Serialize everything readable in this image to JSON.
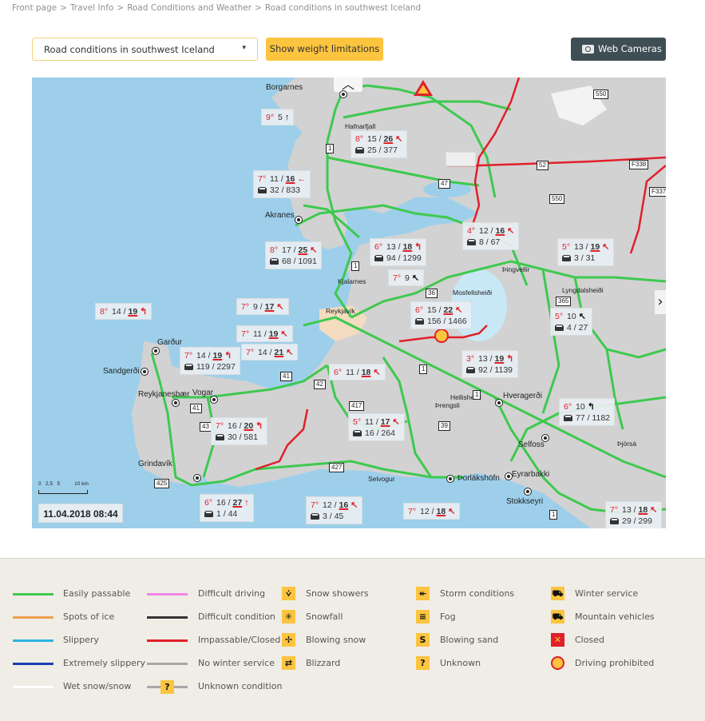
{
  "breadcrumb": [
    "Front page",
    "Travel Info",
    "Road Conditions and Weather",
    "Road conditions in southwest Iceland"
  ],
  "breadcrumb_separator": ">",
  "controls": {
    "region_select_value": "Road conditions in southwest Iceland",
    "weight_button": "Show weight limitations",
    "webcam_button": "Web Cameras"
  },
  "map": {
    "collapse_icon": "chevron-up-icon",
    "next_icon": "chevron-right-icon",
    "timestamp": "11.04.2018  08:44",
    "scale_labels": "0   2,5   5          10 km",
    "places": [
      {
        "name": "Borgarnes",
        "cls": ""
      },
      {
        "name": "Hafnarfjall",
        "cls": "small"
      },
      {
        "name": "Akranes",
        "cls": ""
      },
      {
        "name": "Kjalarnes",
        "cls": "small"
      },
      {
        "name": "Mosfellsheiði",
        "cls": "small"
      },
      {
        "name": "Þingvellir",
        "cls": "small"
      },
      {
        "name": "Lyngdalsheiði",
        "cls": "small"
      },
      {
        "name": "Reykjavík",
        "cls": "small"
      },
      {
        "name": "Garður",
        "cls": ""
      },
      {
        "name": "Sandgerði",
        "cls": ""
      },
      {
        "name": "Reykjanesbær",
        "cls": ""
      },
      {
        "name": "Vogar",
        "cls": ""
      },
      {
        "name": "Hellisheiði",
        "cls": "small"
      },
      {
        "name": "Þrengsli",
        "cls": "small"
      },
      {
        "name": "Hveragerði",
        "cls": ""
      },
      {
        "name": "Selfoss",
        "cls": ""
      },
      {
        "name": "Þjórsá",
        "cls": "small"
      },
      {
        "name": "Grindavík",
        "cls": ""
      },
      {
        "name": "Selvogur",
        "cls": "small"
      },
      {
        "name": "Þorlákshöfn",
        "cls": ""
      },
      {
        "name": "Eyrarbakki",
        "cls": ""
      },
      {
        "name": "Stokkseyri",
        "cls": ""
      }
    ],
    "road_numbers": [
      "550",
      "52",
      "F338",
      "F337",
      "550",
      "1",
      "47",
      "1",
      "36",
      "365",
      "41",
      "42",
      "1",
      "1",
      "417",
      "39",
      "43",
      "41",
      "1",
      "425",
      "427"
    ],
    "weather_stations": [
      {
        "temp": "9°",
        "wind": "5",
        "gust": "",
        "dir": "↑",
        "dir_color": "black",
        "traffic": ""
      },
      {
        "temp": "8°",
        "wind": "15 /",
        "gust": "26",
        "dir": "↖",
        "dir_color": "red",
        "traffic": "25 / 377"
      },
      {
        "temp": "7°",
        "wind": "11 /",
        "gust": "16",
        "dir": "←",
        "dir_color": "red",
        "traffic": "32 / 833"
      },
      {
        "temp": "8°",
        "wind": "17 /",
        "gust": "25",
        "dir": "↖",
        "dir_color": "red",
        "traffic": "68 / 1091"
      },
      {
        "temp": "6°",
        "wind": "13 /",
        "gust": "18",
        "dir": "↰",
        "dir_color": "red",
        "traffic": "94 / 1299"
      },
      {
        "temp": "4°",
        "wind": "12 /",
        "gust": "16",
        "dir": "↖",
        "dir_color": "red",
        "traffic": "8 / 67"
      },
      {
        "temp": "5°",
        "wind": "13 /",
        "gust": "19",
        "dir": "↖",
        "dir_color": "red",
        "traffic": "3 / 31"
      },
      {
        "temp": "7°",
        "wind": "9",
        "gust": "",
        "dir": "↖",
        "dir_color": "black",
        "traffic": ""
      },
      {
        "temp": "8°",
        "wind": "14 /",
        "gust": "19",
        "dir": "↰",
        "dir_color": "red",
        "traffic": ""
      },
      {
        "temp": "7°",
        "wind": "9 /",
        "gust": "17",
        "dir": "↖",
        "dir_color": "red",
        "traffic": ""
      },
      {
        "temp": "6°",
        "wind": "15 /",
        "gust": "22",
        "dir": "↖",
        "dir_color": "red",
        "traffic": "156 / 1466"
      },
      {
        "temp": "5°",
        "wind": "10",
        "gust": "",
        "dir": "↖",
        "dir_color": "black",
        "traffic": "4 / 27"
      },
      {
        "temp": "7°",
        "wind": "11 /",
        "gust": "19",
        "dir": "↖",
        "dir_color": "red",
        "traffic": ""
      },
      {
        "temp": "7°",
        "wind": "14 /",
        "gust": "21",
        "dir": "↖",
        "dir_color": "red",
        "traffic": ""
      },
      {
        "temp": "7°",
        "wind": "14 /",
        "gust": "19",
        "dir": "↰",
        "dir_color": "red",
        "traffic": "119 / 2297"
      },
      {
        "temp": "3°",
        "wind": "13 /",
        "gust": "19",
        "dir": "↰",
        "dir_color": "red",
        "traffic": "92 / 1139"
      },
      {
        "temp": "6°",
        "wind": "11 /",
        "gust": "18",
        "dir": "↖",
        "dir_color": "red",
        "traffic": ""
      },
      {
        "temp": "6°",
        "wind": "10",
        "gust": "",
        "dir": "↰",
        "dir_color": "black",
        "traffic": "77 / 1182"
      },
      {
        "temp": "7°",
        "wind": "16 /",
        "gust": "20",
        "dir": "↰",
        "dir_color": "red",
        "traffic": "30 / 581"
      },
      {
        "temp": "5°",
        "wind": "11 /",
        "gust": "17",
        "dir": "↖",
        "dir_color": "red",
        "traffic": "16 / 264"
      },
      {
        "temp": "6°",
        "wind": "16 /",
        "gust": "27",
        "dir": "↑",
        "dir_color": "red",
        "traffic": "1 / 44"
      },
      {
        "temp": "7°",
        "wind": "12 /",
        "gust": "16",
        "dir": "↖",
        "dir_color": "red",
        "traffic": "3 / 45"
      },
      {
        "temp": "7°",
        "wind": "12 /",
        "gust": "18",
        "dir": "↖",
        "dir_color": "red",
        "traffic": ""
      },
      {
        "temp": "7°",
        "wind": "13 /",
        "gust": "18",
        "dir": "↖",
        "dir_color": "red",
        "traffic": "29 / 299"
      }
    ]
  },
  "legend": {
    "lines": [
      {
        "label": "Easily passable",
        "color": "#3ec94f"
      },
      {
        "label": "Spots of ice",
        "color": "#f0a050"
      },
      {
        "label": "Slippery",
        "color": "#2ab4e0"
      },
      {
        "label": "Extremely slippery",
        "color": "#1a3fb0"
      },
      {
        "label": "Wet snow/snow",
        "color": "#ffffff"
      },
      {
        "label": "Difficult driving",
        "color": "#ee88e8"
      },
      {
        "label": "Difficult condition",
        "color": "#333333"
      },
      {
        "label": "Impassable/Closed",
        "color": "#e0202a"
      },
      {
        "label": "No winter service",
        "color": "#a8a8a8"
      },
      {
        "label": "Unknown condition",
        "color": "#a8a8a8"
      }
    ],
    "icons": [
      {
        "label": "Snow showers",
        "glyph": "⩒",
        "icon": "snow-showers-icon"
      },
      {
        "label": "Snowfall",
        "glyph": "✳",
        "icon": "snowfall-icon"
      },
      {
        "label": "Blowing snow",
        "glyph": "✢",
        "icon": "blowing-snow-icon"
      },
      {
        "label": "Blizzard",
        "glyph": "⇄",
        "icon": "blizzard-icon"
      },
      {
        "label": "Storm conditions",
        "glyph": "↞",
        "icon": "storm-icon"
      },
      {
        "label": "Fog",
        "glyph": "≡",
        "icon": "fog-icon"
      },
      {
        "label": "Blowing sand",
        "glyph": "S",
        "icon": "blowing-sand-icon"
      },
      {
        "label": "Unknown",
        "glyph": "?",
        "icon": "unknown-icon"
      },
      {
        "label": "Winter service",
        "glyph": "⛟",
        "icon": "winter-service-icon"
      },
      {
        "label": "Mountain vehicles",
        "glyph": "⛟",
        "icon": "mountain-vehicles-icon"
      },
      {
        "label": "Closed",
        "glyph": "✕",
        "icon": "closed-icon"
      },
      {
        "label": "Driving prohibited",
        "glyph": "",
        "icon": "driving-prohibited-icon"
      }
    ],
    "unknown_glyph": "?"
  }
}
